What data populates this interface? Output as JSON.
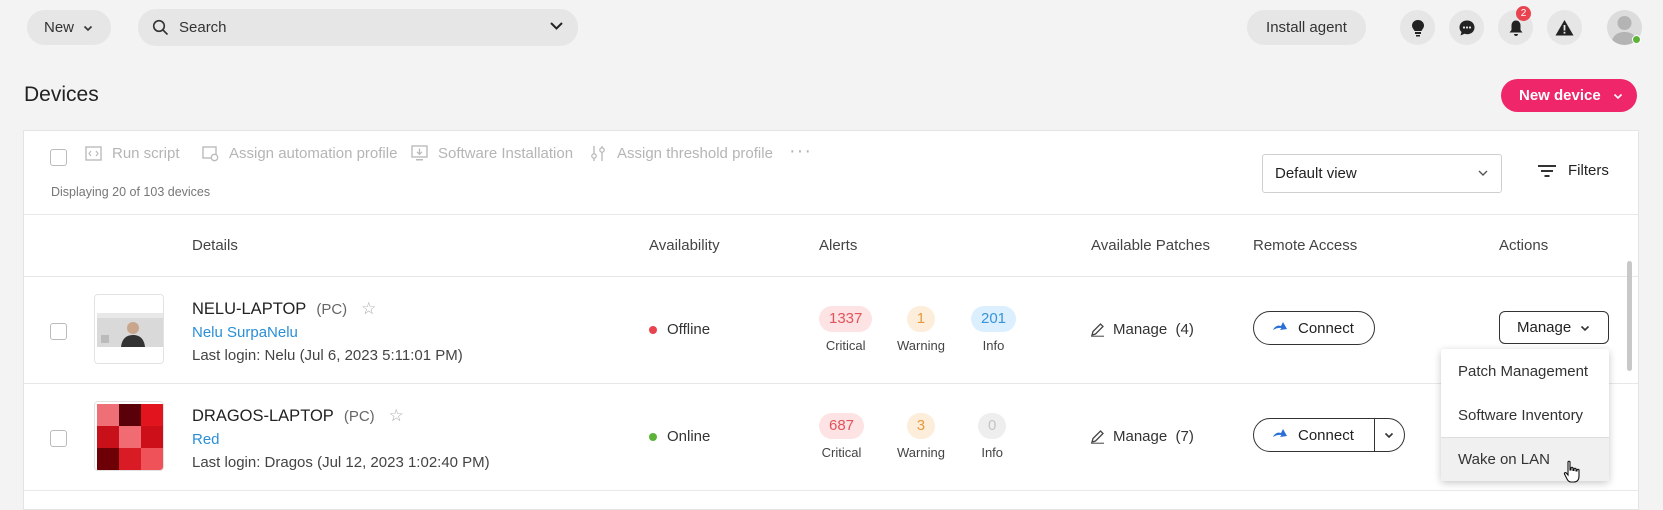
{
  "header": {
    "new_label": "New",
    "search_placeholder": "Search",
    "install_agent_label": "Install agent",
    "notification_count": "2"
  },
  "page": {
    "title": "Devices",
    "new_device_label": "New device"
  },
  "toolbar": {
    "run_script": "Run script",
    "assign_automation_profile": "Assign automation profile",
    "software_installation": "Software Installation",
    "assign_threshold_profile": "Assign threshold profile",
    "more": "···",
    "displaying": "Displaying 20 of 103 devices",
    "view_selected": "Default view",
    "filters_label": "Filters"
  },
  "columns": {
    "details": "Details",
    "availability": "Availability",
    "alerts": "Alerts",
    "patches": "Available Patches",
    "remote": "Remote Access",
    "actions": "Actions"
  },
  "devices": [
    {
      "name": "NELU-LAPTOP",
      "type": "(PC)",
      "owner": "Nelu SurpaNelu",
      "last_login": "Last login: Nelu (Jul 6, 2023 5:11:01 PM)",
      "availability": "Offline",
      "availability_color": "#e8434f",
      "alerts": {
        "critical": "1337",
        "critical_label": "Critical",
        "warning": "1",
        "warning_label": "Warning",
        "info": "201",
        "info_label": "Info"
      },
      "patches": "Manage  (4)",
      "connect": "Connect",
      "action": "Manage"
    },
    {
      "name": "DRAGOS-LAPTOP",
      "type": "(PC)",
      "owner": "Red",
      "last_login": "Last login: Dragos (Jul 12, 2023 1:02:40 PM)",
      "availability": "Online",
      "availability_color": "#5cb338",
      "alerts": {
        "critical": "687",
        "critical_label": "Critical",
        "warning": "3",
        "warning_label": "Warning",
        "info": "0",
        "info_label": "Info"
      },
      "patches": "Manage  (7)",
      "connect": "Connect"
    }
  ],
  "actions_menu": {
    "items": [
      "Patch Management",
      "Software Inventory",
      "Wake on LAN"
    ]
  },
  "colors": {
    "accent": "#f0266b",
    "critical_bg": "#fde3e3",
    "critical_fg": "#e0535b",
    "warning_bg": "#fdeedc",
    "warning_fg": "#e79a3c",
    "info_bg": "#dcefff",
    "info_fg": "#3a93d6",
    "info_zero_bg": "#eeeeee",
    "info_zero_fg": "#c4c4c4"
  }
}
